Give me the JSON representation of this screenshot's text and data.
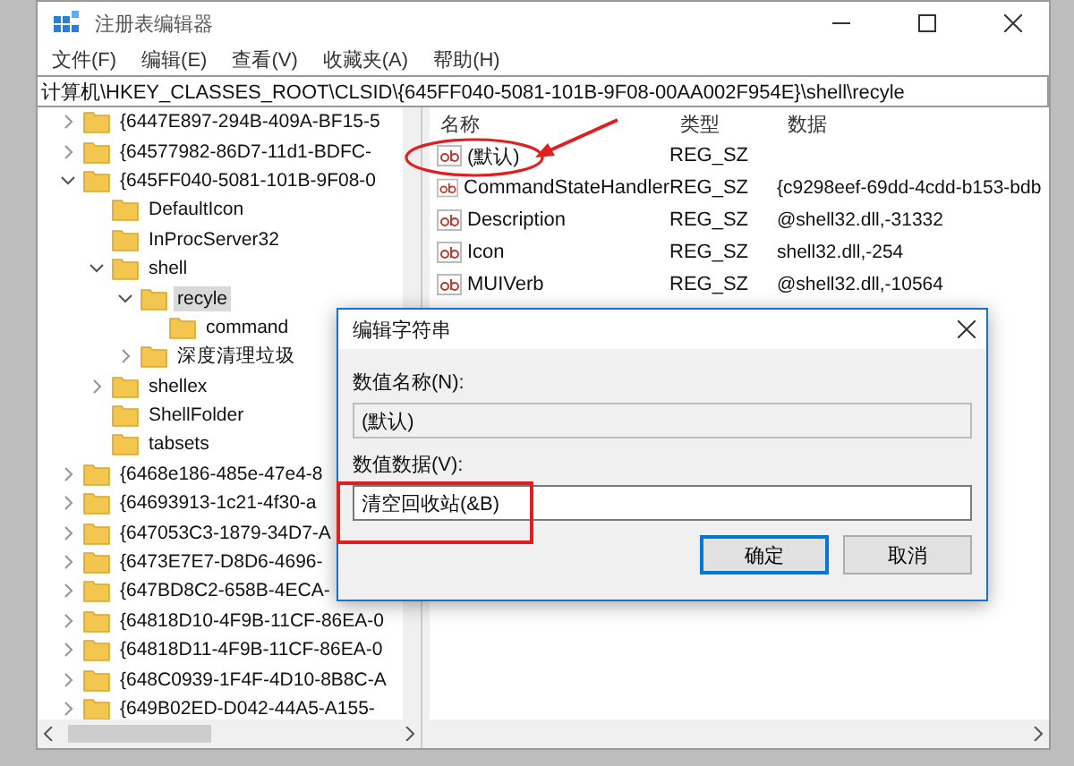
{
  "window": {
    "title": "注册表编辑器"
  },
  "menu": [
    "文件(F)",
    "编辑(E)",
    "查看(V)",
    "收藏夹(A)",
    "帮助(H)"
  ],
  "address": "计算机\\HKEY_CLASSES_ROOT\\CLSID\\{645FF040-5081-101B-9F08-00AA002F954E}\\shell\\recyle",
  "tree": [
    {
      "label": "{6447E897-294B-409A-BF15-5",
      "has_children": true,
      "expanded": false,
      "selected": false
    },
    {
      "label": "{64577982-86D7-11d1-BDFC-",
      "has_children": true,
      "expanded": false,
      "selected": false
    },
    {
      "label": "{645FF040-5081-101B-9F08-0",
      "has_children": true,
      "expanded": true,
      "selected": false,
      "children": [
        {
          "label": "DefaultIcon",
          "has_children": false,
          "expanded": false,
          "selected": false
        },
        {
          "label": "InProcServer32",
          "has_children": false,
          "expanded": false,
          "selected": false
        },
        {
          "label": "shell",
          "has_children": true,
          "expanded": true,
          "selected": false,
          "children": [
            {
              "label": "recyle",
              "has_children": true,
              "expanded": true,
              "selected": true,
              "children": [
                {
                  "label": "command",
                  "has_children": false,
                  "expanded": false,
                  "selected": false
                }
              ]
            },
            {
              "label": "深度清理垃圾",
              "has_children": true,
              "expanded": false,
              "selected": false
            }
          ]
        },
        {
          "label": "shellex",
          "has_children": true,
          "expanded": false,
          "selected": false
        },
        {
          "label": "ShellFolder",
          "has_children": false,
          "expanded": false,
          "selected": false
        },
        {
          "label": "tabsets",
          "has_children": false,
          "expanded": false,
          "selected": false
        }
      ]
    },
    {
      "label": "{6468e186-485e-47e4-8",
      "has_children": true,
      "expanded": false,
      "selected": false
    },
    {
      "label": "{64693913-1c21-4f30-a",
      "has_children": true,
      "expanded": false,
      "selected": false
    },
    {
      "label": "{647053C3-1879-34D7-A",
      "has_children": true,
      "expanded": false,
      "selected": false
    },
    {
      "label": "{6473E7E7-D8D6-4696-",
      "has_children": true,
      "expanded": false,
      "selected": false
    },
    {
      "label": "{647BD8C2-658B-4ECA-",
      "has_children": true,
      "expanded": false,
      "selected": false
    },
    {
      "label": "{64818D10-4F9B-11CF-86EA-0",
      "has_children": true,
      "expanded": false,
      "selected": false
    },
    {
      "label": "{64818D11-4F9B-11CF-86EA-0",
      "has_children": true,
      "expanded": false,
      "selected": false
    },
    {
      "label": "{648C0939-1F4F-4D10-8B8C-A",
      "has_children": true,
      "expanded": false,
      "selected": false
    },
    {
      "label": "{649B02ED-D042-44A5-A155-",
      "has_children": true,
      "expanded": false,
      "selected": false
    }
  ],
  "values": {
    "columns": [
      "名称",
      "类型",
      "数据"
    ],
    "rows": [
      {
        "name": "(默认)",
        "type": "REG_SZ"
      },
      {
        "name": "CommandStateHandler",
        "type": "REG_SZ",
        "data": "{c9298eef-69dd-4cdd-b153-bdb"
      },
      {
        "name": "Description",
        "type": "REG_SZ",
        "data": "@shell32.dll,-31332"
      },
      {
        "name": "Icon",
        "type": "REG_SZ",
        "data": "shell32.dll,-254"
      },
      {
        "name": "MUIVerb",
        "type": "REG_SZ",
        "data": "@shell32.dll,-10564"
      }
    ]
  },
  "dialog": {
    "title": "编辑字符串",
    "name_label": "数值名称(N):",
    "name_field": {
      "value": "(默认)",
      "disabled": true
    },
    "data_label": "数值数据(V):",
    "data_field": {
      "value": "清空回收站(&B)",
      "disabled": false
    },
    "buttons": [
      {
        "label": "确定",
        "default": true
      },
      {
        "label": "取消",
        "default": false
      }
    ]
  },
  "annotations": [
    {
      "kind": "ellipse"
    },
    {
      "kind": "arrow"
    },
    {
      "kind": "rectangle"
    }
  ]
}
